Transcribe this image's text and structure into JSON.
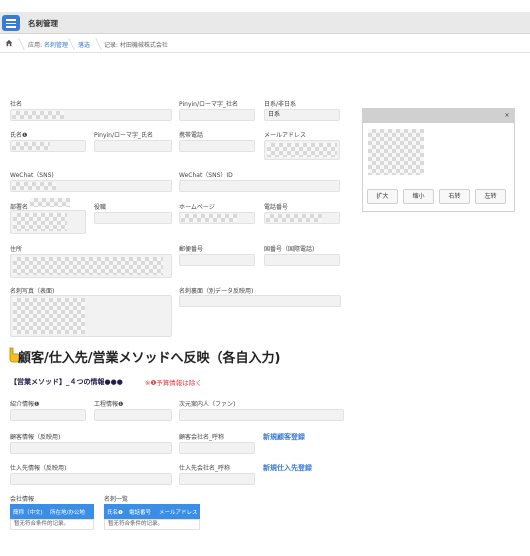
{
  "header": {
    "title": "名刺管理"
  },
  "breadcrumb": {
    "app_label": "应用:",
    "app_link": "名刺管理",
    "section": "落选",
    "record": "记录: 村田機械株式会社"
  },
  "form": {
    "company_name_label": "社名",
    "company_pinyin_label": "Pinyin/ローマ字_社名",
    "nikkei_label": "日系/非日系",
    "nikkei_value": "日系",
    "name_label": "氏名❶",
    "name_pinyin_label": "Pinyin/ローマ字_氏名",
    "mobile_label": "携帯電話",
    "email_label": "メールアドレス",
    "wechat_label": "WeChat（SNS)",
    "wechat_id_label": "WeChat（SNS）ID",
    "department_label": "部署名",
    "position_label": "役職",
    "homepage_label": "ホームページ",
    "phone_label": "電話番号",
    "address_label": "住所",
    "postal_label": "郵便番号",
    "country_code_label": "国番号（国際電話)",
    "card_front_label": "名刺写真（表面)",
    "card_back_label": "名刺裏面（別データ反映用)"
  },
  "image_panel": {
    "close_label": "×",
    "buttons": [
      "扩大",
      "缩小",
      "右转",
      "左转"
    ]
  },
  "reflect": {
    "heading": "顧客/仕入先/営業メソッドへ反映（各自入力)",
    "method_title": "【営業メソッド】_４つの情報●●●",
    "warning": "※❶予算情報は除く",
    "intro_label": "紹介情報❶",
    "process_label": "工程情報❶",
    "guide_label": "次元案内人（ファン)",
    "customer_info_label": "顧客情報（反映用)",
    "customer_call_label": "顧客会社名_呼称",
    "new_customer_link": "新規顧客登録",
    "supplier_info_label": "仕入先情報（反映用)",
    "supplier_call_label": "仕入先会社名_呼称",
    "new_supplier_link": "新規仕入先登録",
    "company_info_label": "会社情報",
    "card_list_label": "名刺一覧",
    "company_table": {
      "columns": [
        "簡称（中文)",
        "所在地/办公地"
      ],
      "empty": "暂无符合条件的记录。"
    },
    "card_table": {
      "columns": [
        "氏名❶",
        "電話番号",
        "メールアドレス"
      ],
      "empty": "暂无符合条件的记录。"
    }
  }
}
